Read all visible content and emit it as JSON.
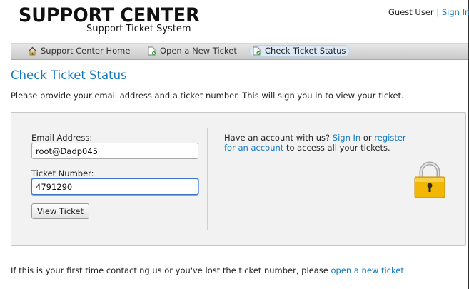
{
  "logo": {
    "title": "SUPPORT CENTER",
    "subtitle": "Support Ticket System"
  },
  "user": {
    "guest_label": "Guest User",
    "separator": "|",
    "sign_in": "Sign In"
  },
  "nav": {
    "items": [
      {
        "label": "Support Center Home",
        "icon": "home-icon"
      },
      {
        "label": "Open a New Ticket",
        "icon": "new-ticket-icon"
      },
      {
        "label": "Check Ticket Status",
        "icon": "ticket-status-icon",
        "active": true
      }
    ]
  },
  "page": {
    "title": "Check Ticket Status",
    "intro": "Please provide your email address and a ticket number. This will sign you in to view your ticket."
  },
  "form": {
    "email_label": "Email Address:",
    "email_value": "root@Dadp045",
    "ticket_label": "Ticket Number:",
    "ticket_value": "4791290",
    "submit_label": "View Ticket"
  },
  "account": {
    "text_before": "Have an account with us?",
    "sign_in_link": "Sign In",
    "or_text": "or",
    "register_link": "register for an account",
    "text_after": "to access all your tickets."
  },
  "footer": {
    "text": "If this is your first time contacting us or you've lost the ticket number, please",
    "link": "open a new ticket"
  },
  "colors": {
    "link": "#1279c0",
    "title": "#1279c0",
    "lock": "#f2b705"
  }
}
